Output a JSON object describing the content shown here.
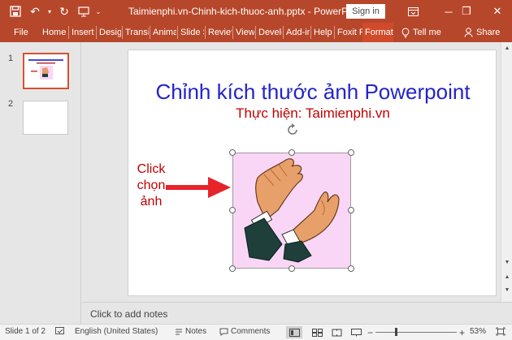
{
  "window": {
    "doc_title": "Taimienphi.vn-Chinh-kich-thuoc-anh.pptx  -  PowerPoint",
    "signin_label": "Sign in",
    "minimize_glyph": "─",
    "restore_glyph": "❐",
    "close_glyph": "✕"
  },
  "qat": {
    "save_icon": "💾",
    "undo_icon": "↶",
    "redo_icon": "↻",
    "dropdown_glyph": "▾",
    "customize_glyph": "⌄"
  },
  "ribbon": {
    "tabs": [
      {
        "label": "File"
      },
      {
        "label": "Home"
      },
      {
        "label": "Insert"
      },
      {
        "label": "Desigr"
      },
      {
        "label": "Transit"
      },
      {
        "label": "Anima"
      },
      {
        "label": "Slide S"
      },
      {
        "label": "Reviev"
      },
      {
        "label": "View"
      },
      {
        "label": "Develc"
      },
      {
        "label": "Add-ir"
      },
      {
        "label": "Help"
      },
      {
        "label": "Foxit R"
      },
      {
        "label": "Format"
      }
    ],
    "tell_me": "Tell me",
    "share": "Share"
  },
  "thumbnails": [
    {
      "number": "1"
    },
    {
      "number": "2"
    }
  ],
  "slide": {
    "title": "Chỉnh kích thước ảnh Powerpoint",
    "subtitle": "Thực hiện: Taimienphi.vn",
    "callout_lines": [
      "Click",
      "chọn",
      "ảnh"
    ]
  },
  "notes_placeholder": "Click to add notes",
  "statusbar": {
    "slide_info": "Slide 1 of 2",
    "language": "English (United States)",
    "notes_label": "Notes",
    "comments_label": "Comments",
    "zoom": "53%",
    "zoom_fraction": 0.53
  },
  "colors": {
    "accent": "#b7472a",
    "title_text": "#2424c8",
    "subtitle_text": "#c00000",
    "picture_bg": "#fad6f6"
  }
}
